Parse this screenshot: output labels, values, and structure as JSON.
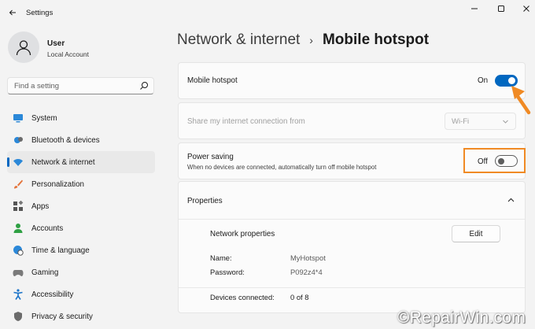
{
  "window": {
    "app_title": "Settings"
  },
  "user": {
    "name": "User",
    "account_type": "Local Account"
  },
  "search": {
    "placeholder": "Find a setting"
  },
  "nav": {
    "items": [
      {
        "label": "System",
        "icon": "monitor-icon",
        "color": "#0078d4"
      },
      {
        "label": "Bluetooth & devices",
        "icon": "bluetooth-icon",
        "color": "#0078d4"
      },
      {
        "label": "Network & internet",
        "icon": "wifi-icon",
        "color": "#0078d4",
        "active": true
      },
      {
        "label": "Personalization",
        "icon": "brush-icon",
        "color": "#e3733a"
      },
      {
        "label": "Apps",
        "icon": "apps-icon",
        "color": "#555555"
      },
      {
        "label": "Accounts",
        "icon": "person-icon",
        "color": "#2ea043"
      },
      {
        "label": "Time & language",
        "icon": "globe-clock-icon",
        "color": "#0078d4"
      },
      {
        "label": "Gaming",
        "icon": "gamepad-icon",
        "color": "#777777"
      },
      {
        "label": "Accessibility",
        "icon": "accessibility-icon",
        "color": "#1a73c8"
      },
      {
        "label": "Privacy & security",
        "icon": "shield-icon",
        "color": "#666666"
      }
    ]
  },
  "header": {
    "parent": "Network & internet",
    "separator": "›",
    "current": "Mobile hotspot"
  },
  "hotspot": {
    "title": "Mobile hotspot",
    "state_label": "On",
    "enabled": true
  },
  "share": {
    "title": "Share my internet connection from",
    "selected": "Wi-Fi",
    "disabled": true
  },
  "power_saving": {
    "title": "Power saving",
    "description": "When no devices are connected, automatically turn off mobile hotspot",
    "state_label": "Off",
    "enabled": false
  },
  "properties": {
    "title": "Properties",
    "network_properties_label": "Network properties",
    "edit_label": "Edit",
    "name_key": "Name:",
    "name_value": "MyHotspot",
    "password_key": "Password:",
    "password_value": "P092z4*4",
    "devices_key": "Devices connected:",
    "devices_value": "0 of 8"
  },
  "watermark": "©RepairWin.com",
  "colors": {
    "accent": "#0067c0",
    "annotation": "#f08a24"
  }
}
